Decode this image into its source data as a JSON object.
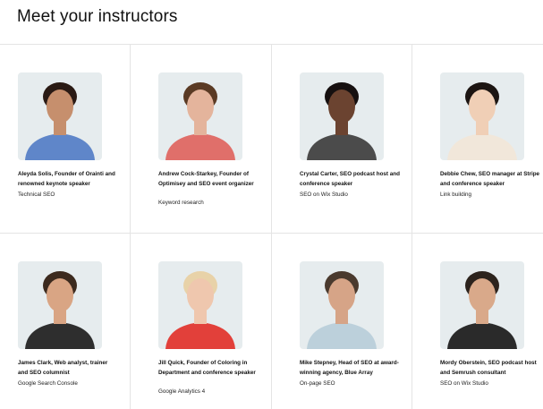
{
  "page": {
    "title": "Meet your instructors"
  },
  "instructors": [
    {
      "name": "Aleyda Solis, Founder of Orainti and renowned keynote speaker",
      "topic": "Technical SEO",
      "skin": "#c68f6d",
      "hair": "#2a1a14",
      "shirt": "#5f86c9"
    },
    {
      "name": "Andrew Cock-Starkey, Founder of Optimisey and SEO event organizer",
      "topic": "Keyword research",
      "skin": "#e4b49c",
      "hair": "#5a3a24",
      "shirt": "#e06f6a"
    },
    {
      "name": "Crystal Carter, SEO podcast host and conference speaker",
      "topic": "SEO on Wix Studio",
      "skin": "#6b4330",
      "hair": "#161010",
      "shirt": "#4b4b4b"
    },
    {
      "name": "Debbie Chew, SEO manager at Stripe and conference speaker",
      "topic": "Link building",
      "skin": "#f0cfb6",
      "hair": "#1c1512",
      "shirt": "#f1e7da"
    },
    {
      "name": "James Clark, Web analyst, trainer and SEO columnist",
      "topic": "Google Search Console",
      "skin": "#d9a584",
      "hair": "#3c2a1e",
      "shirt": "#2e2e2e"
    },
    {
      "name": "Jill Quick, Founder of Coloring in Department and conference speaker",
      "topic": "Google Analytics 4",
      "skin": "#efc7ae",
      "hair": "#e8d2a8",
      "shirt": "#e2403a"
    },
    {
      "name": "Mike Stepney, Head of SEO at award-winning agency, Blue Array",
      "topic": "On-page SEO",
      "skin": "#d6a487",
      "hair": "#4a3a2e",
      "shirt": "#bcd0db"
    },
    {
      "name": "Mordy Oberstein, SEO podcast host and Semrush consultant",
      "topic": "SEO on Wix Studio",
      "skin": "#d9a98a",
      "hair": "#2c231d",
      "shirt": "#2a2a2a"
    }
  ]
}
